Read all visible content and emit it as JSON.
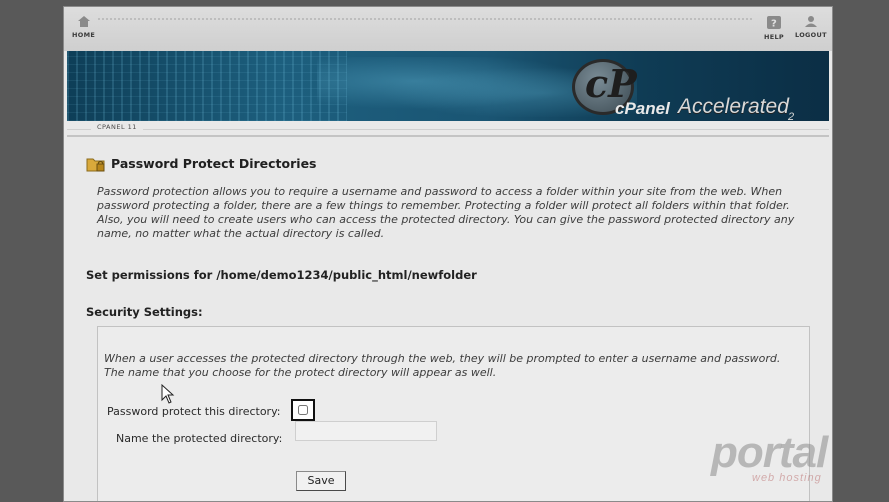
{
  "nav": {
    "home_label": "HOME",
    "help_label": "HELP",
    "logout_label": "LOGOUT"
  },
  "branding": {
    "logo_cp": "cP",
    "logo_cpanel": "cPanel",
    "logo_accelerated": "Accelerated",
    "logo_version": "2"
  },
  "breadcrumb": "CPANEL 11",
  "page": {
    "title": "Password Protect Directories",
    "intro": "Password protection allows you to require a username and password to access a folder within your site from the web. When password protecting a folder, there are a few things to remember. Protecting a folder will protect all folders within that folder. Also, you will need to create users who can access the protected directory. You can give the password protected directory any name, no matter what the actual directory is called.",
    "permissions_heading": "Set permissions for /home/demo1234/public_html/newfolder",
    "security_heading": "Security Settings:"
  },
  "security": {
    "notice": "When a user accesses the protected directory through the web, they will be prompted to enter a username and password. The name that you choose for the protect directory will appear as well.",
    "protect_label": "Password protect this directory:",
    "protect_checked": false,
    "name_label": "Name the protected directory:",
    "name_value": "",
    "save_label": "Save"
  },
  "watermark": {
    "brand": "portal",
    "sub": "web hosting"
  },
  "colors": {
    "backdrop": "#595959",
    "page_bg": "#e9e9e9",
    "banner": "#1d5f7e"
  }
}
